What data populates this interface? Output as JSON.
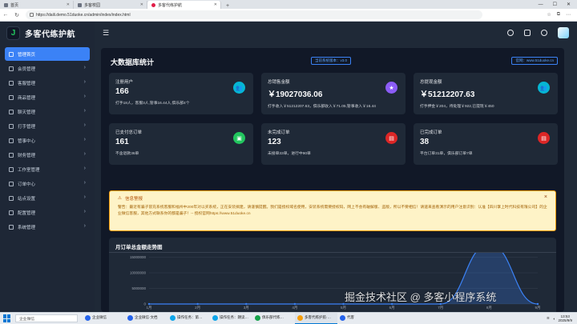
{
  "browser": {
    "tabs": [
      {
        "title": "首页"
      },
      {
        "title": "多客校园"
      },
      {
        "title": "多客代练护航"
      }
    ],
    "url": "https://daili.demo.51duoke.cn/admin/index/index.html"
  },
  "app": {
    "brand": "多客代练护航",
    "menu": [
      {
        "label": "管理首页"
      },
      {
        "label": "会员管理"
      },
      {
        "label": "客服管理"
      },
      {
        "label": "商品管理"
      },
      {
        "label": "聊天管理"
      },
      {
        "label": "打手管理"
      },
      {
        "label": "管事中心"
      },
      {
        "label": "财务管理"
      },
      {
        "label": "工作室管理"
      },
      {
        "label": "订单中心"
      },
      {
        "label": "站点设置"
      },
      {
        "label": "配置管理"
      },
      {
        "label": "系统管理"
      }
    ]
  },
  "dashboard": {
    "title": "大数据库统计",
    "version_badge": "当前系统版本：v3.0",
    "site_badge": "官网：www.51duoke.cn",
    "cards": [
      {
        "label": "注册用户",
        "value": "166",
        "sub": "打手18人，客服3人,管事16.44人,俱乐部4个",
        "icon": "users-icon",
        "color": "#06b6d4"
      },
      {
        "label": "总销售金额",
        "value": "￥19027036.06",
        "sub": "打手收入￥51212207.63，俱乐部收入￥71.05,管事收入￥16.44",
        "icon": "medal-icon",
        "color": "#8b5cf6"
      },
      {
        "label": "总提现金额",
        "value": "￥51212207.63",
        "sub": "打手押金￥204，待处理￥922,已提现￥450",
        "icon": "users-icon",
        "color": "#06b6d4"
      },
      {
        "label": "已支付总订单",
        "value": "161",
        "sub": "不含退款36单",
        "icon": "wallet-icon",
        "color": "#22c55e"
      },
      {
        "label": "未完成订单",
        "value": "123",
        "sub": "未接单33单，进行中90单",
        "icon": "file-icon",
        "color": "#dc2626"
      },
      {
        "label": "已完成订单",
        "value": "38",
        "sub": "平台订单31单，俱乐部订单7单",
        "icon": "file-icon",
        "color": "#dc2626"
      }
    ]
  },
  "notice": {
    "title": "信息警报",
    "text": "警告：最近有骗子冒充系统客服和福州中200年对以买系统，正在安装搞建，请谨慎提醒。我们是授权域名使用，安装系统需要授权码，网上不会有破解版、盗版，所以不要相信！请速来查看演示的用户注意识别：认准【四川掌上时代科技有限公司】的企业微信客服，其他方式联系你的都是骗子！-- 授权官网https://www.51duoke.cn"
  },
  "chart_data": {
    "type": "line",
    "title": "月订单总金额走势图",
    "categories": [
      "1月",
      "2月",
      "3月",
      "4月",
      "5月",
      "6月",
      "7月",
      "8月",
      "9月"
    ],
    "series": [
      {
        "values": [
          0,
          0,
          0,
          0,
          0,
          0,
          0,
          19027036.06,
          0
        ]
      }
    ],
    "ytick_labels": [
      "0",
      "5000000",
      "10000000",
      "15000000"
    ],
    "ylim": [
      0,
      20000000
    ],
    "grid": true,
    "colors": {
      "line": "#3b82f6",
      "area": "rgba(59,130,246,0.25)"
    }
  },
  "taskbar": {
    "search_placeholder": "企业微信",
    "apps": [
      {
        "label": "企业微信"
      },
      {
        "label": "企业微信·文档"
      },
      {
        "label": "操作任务：第…"
      },
      {
        "label": "操作任务：朗读…"
      },
      {
        "label": "俱乐部代练…"
      },
      {
        "label": "多客代练护航·…"
      },
      {
        "label": "代客"
      }
    ],
    "clock_time": "13:53",
    "clock_date": "2025/9/9"
  },
  "watermark": "掘金技术社区 @ 多客小程序系统",
  "colors": {
    "accent": "#3b82f6",
    "bg": "#1f2937"
  }
}
